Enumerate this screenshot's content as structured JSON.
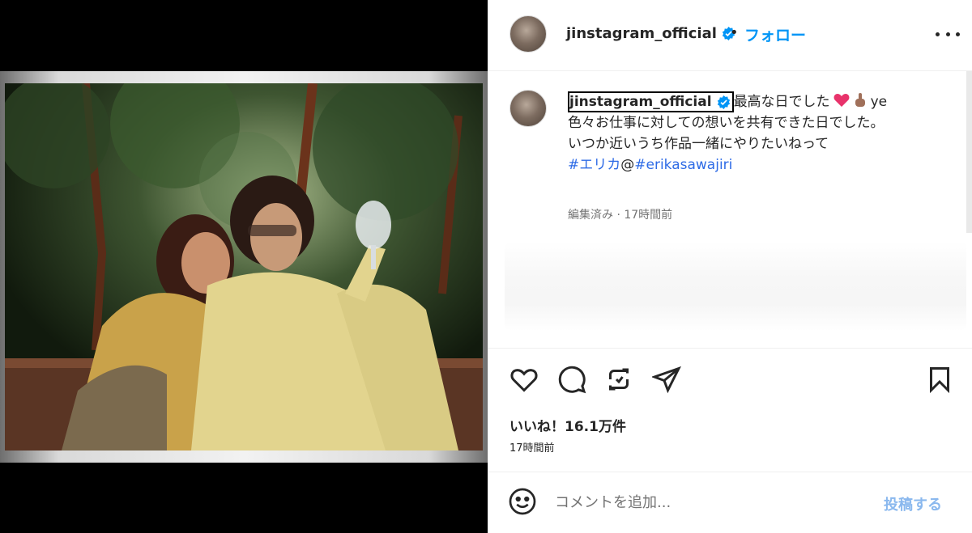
{
  "header": {
    "username": "jinstagram_official",
    "separator": "•",
    "follow_label": "フォロー"
  },
  "caption": {
    "username": "jinstagram_official",
    "line1_text": "最高な日でした",
    "line1_tail": "ye",
    "line2": "色々お仕事に対しての想いを共有できた日でした。",
    "line3": "いつか近いうち作品一緒にやりたいねって",
    "hashtag": "#エリカ",
    "mention_at": "@",
    "hashtag2": "#erikasawajiri",
    "meta": "編集済み · 17時間前"
  },
  "engagement": {
    "likes": "いいね！16.1万件",
    "time": "17時間前"
  },
  "comment": {
    "placeholder": "コメントを追加...",
    "post_label": "投稿する"
  },
  "icons": {
    "like": "heart-icon",
    "comment": "comment-icon",
    "repost": "repost-icon",
    "share": "share-icon",
    "save": "bookmark-icon",
    "emoji": "emoji-icon",
    "more": "more-icon",
    "verified": "verified-badge-icon"
  },
  "colors": {
    "follow": "#0095f6",
    "hashtag": "#2e6be6",
    "post_disabled": "#8ab8ee"
  }
}
